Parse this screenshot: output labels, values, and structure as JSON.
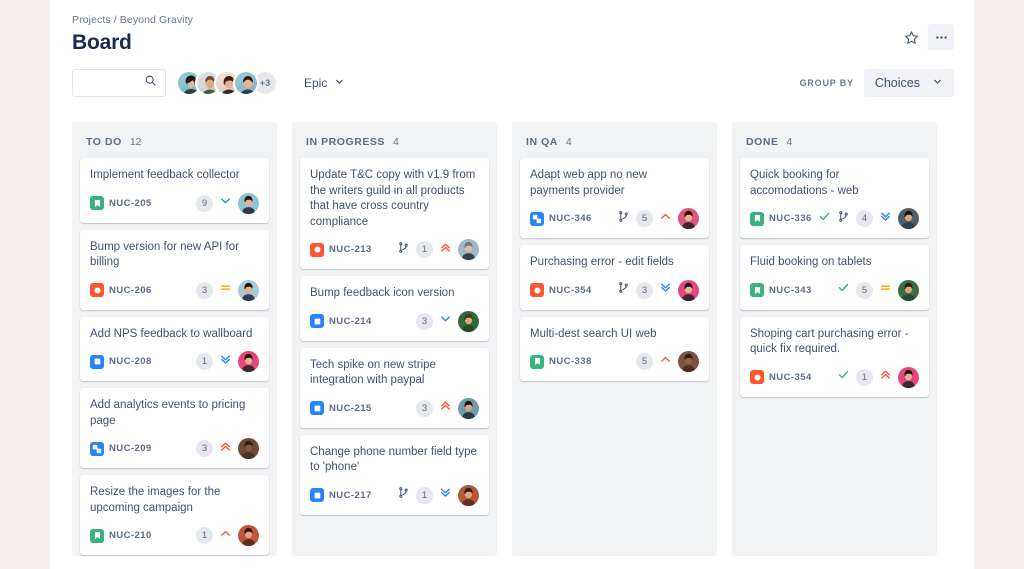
{
  "header": {
    "breadcrumb": "Projects / Beyond Gravity",
    "title": "Board",
    "star_icon": "star-icon",
    "more_icon": "more-actions-icon"
  },
  "toolbar": {
    "search_placeholder": "",
    "search_value": "",
    "search_icon": "search-icon",
    "avatar_overflow": "+3",
    "epic_label": "Epic",
    "epic_chevron": "chevron-down-icon",
    "group_by_label": "GROUP BY",
    "group_by_value": "Choices",
    "group_by_chevron": "chevron-down-icon"
  },
  "columns": [
    {
      "name": "TO DO",
      "count": "12",
      "cards": [
        {
          "title": "Implement feedback collector",
          "key": "NUC-205",
          "type": "story",
          "done": false,
          "branch": false,
          "points": "9",
          "priority": "low",
          "avatar": "a1"
        },
        {
          "title": "Bump version for new API for billing",
          "key": "NUC-206",
          "type": "bug",
          "done": false,
          "branch": false,
          "points": "3",
          "priority": "medium",
          "avatar": "a2"
        },
        {
          "title": "Add NPS feedback to wallboard",
          "key": "NUC-208",
          "type": "task",
          "done": false,
          "branch": false,
          "points": "1",
          "priority": "lowest",
          "avatar": "a3"
        },
        {
          "title": "Add analytics events to pricing page",
          "key": "NUC-209",
          "type": "subtask",
          "done": false,
          "branch": false,
          "points": "3",
          "priority": "highest",
          "avatar": "a4"
        },
        {
          "title": "Resize the images for the upcoming campaign",
          "key": "NUC-210",
          "type": "story",
          "done": false,
          "branch": false,
          "points": "1",
          "priority": "high",
          "avatar": "a5"
        }
      ]
    },
    {
      "name": "IN PROGRESS",
      "count": "4",
      "cards": [
        {
          "title": "Update T&C copy with v1.9 from the writers guild in all products that have cross country compliance",
          "key": "NUC-213",
          "type": "bug",
          "done": false,
          "branch": true,
          "points": "1",
          "priority": "highest",
          "avatar": "a6"
        },
        {
          "title": "Bump feedback icon version",
          "key": "NUC-214",
          "type": "task",
          "done": false,
          "branch": false,
          "points": "3",
          "priority": "low",
          "avatar": "a7"
        },
        {
          "title": "Tech spike on new stripe integration with paypal",
          "key": "NUC-215",
          "type": "task",
          "done": false,
          "branch": false,
          "points": "3",
          "priority": "highest",
          "avatar": "a8"
        },
        {
          "title": "Change phone number field type to 'phone'",
          "key": "NUC-217",
          "type": "task",
          "done": false,
          "branch": true,
          "points": "1",
          "priority": "lowest",
          "avatar": "a9"
        }
      ]
    },
    {
      "name": "IN QA",
      "count": "4",
      "cards": [
        {
          "title": "Adapt web app no new payments provider",
          "key": "NUC-346",
          "type": "subtask",
          "done": false,
          "branch": true,
          "points": "5",
          "priority": "high",
          "avatar": "a10"
        },
        {
          "title": "Purchasing error - edit fields",
          "key": "NUC-354",
          "type": "bug",
          "done": false,
          "branch": true,
          "points": "3",
          "priority": "lowest",
          "avatar": "a11"
        },
        {
          "title": "Multi-dest search UI web",
          "key": "NUC-338",
          "type": "story",
          "done": false,
          "branch": false,
          "points": "5",
          "priority": "high",
          "avatar": "a12"
        }
      ]
    },
    {
      "name": "DONE",
      "count": "4",
      "cards": [
        {
          "title": "Quick booking for accomodations - web",
          "key": "NUC-336",
          "type": "story",
          "done": true,
          "branch": true,
          "points": "4",
          "priority": "lowest",
          "avatar": "a13"
        },
        {
          "title": "Fluid booking on tablets",
          "key": "NUC-343",
          "type": "story",
          "done": true,
          "branch": false,
          "points": "5",
          "priority": "medium",
          "avatar": "a14"
        },
        {
          "title": "Shoping cart purchasing error - quick fix required.",
          "key": "NUC-354",
          "type": "bug",
          "done": true,
          "branch": false,
          "points": "1",
          "priority": "highest",
          "avatar": "a15"
        }
      ]
    }
  ],
  "colors": {
    "story_green": "#36b37e",
    "bug_red": "#ff5630",
    "task_blue": "#2684ff",
    "subtask_blue": "#2684ff",
    "priority_high": "#ff5630",
    "priority_medium": "#ffab00",
    "priority_low": "#2684ff",
    "done_check": "#36b37e",
    "page_bg": "#f5efe9",
    "column_bg": "#f2f3f5",
    "text_primary": "#172b4d",
    "text_secondary": "#5e6c84"
  }
}
